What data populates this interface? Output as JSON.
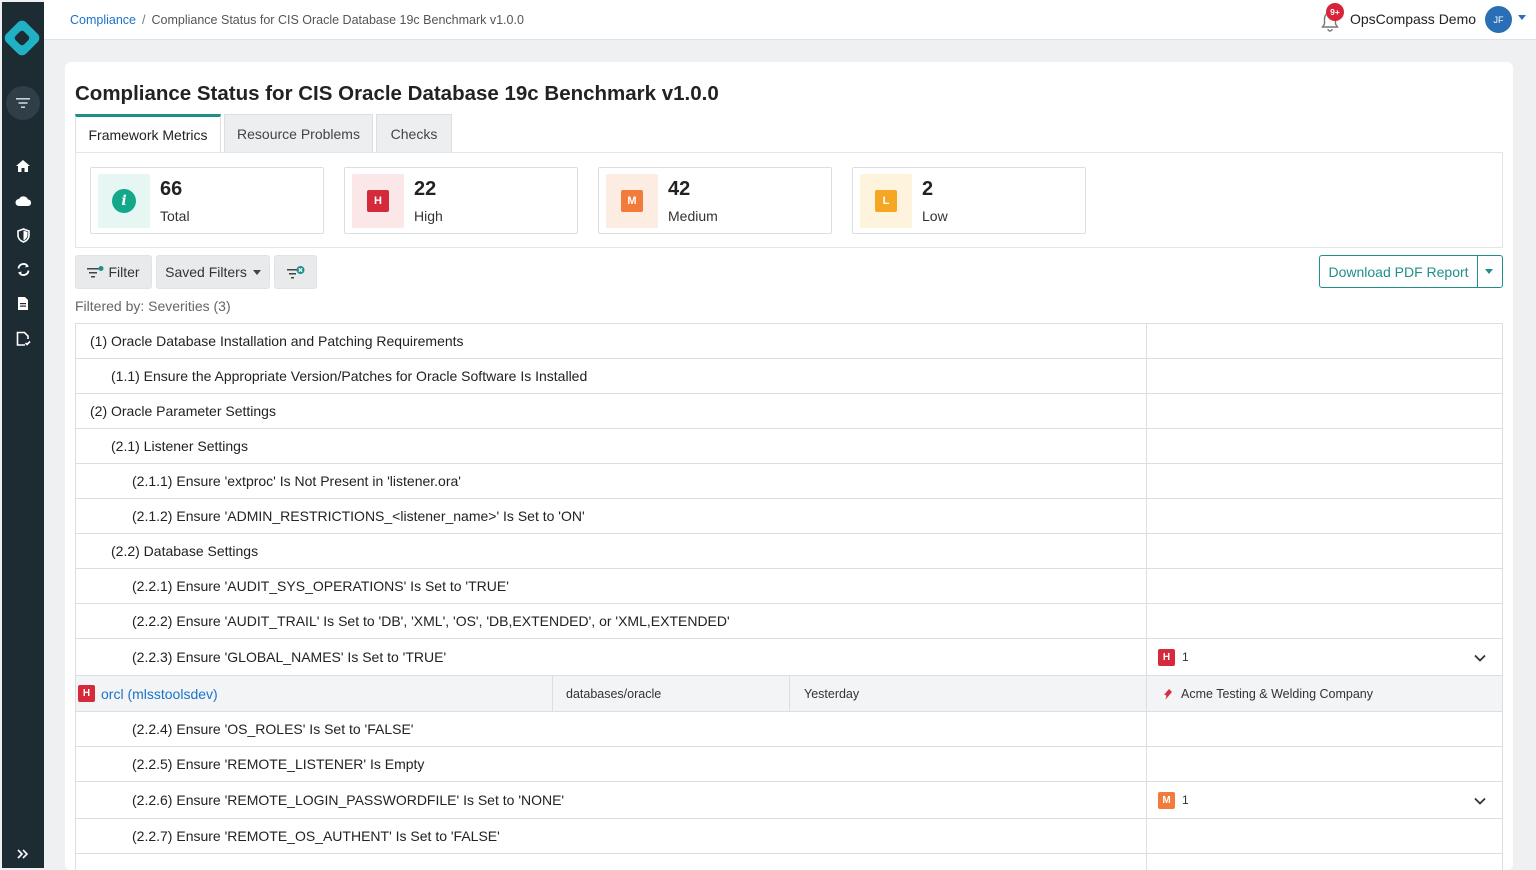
{
  "breadcrumb": {
    "root": "Compliance",
    "separator": "/",
    "current": "Compliance Status for CIS Oracle Database 19c Benchmark v1.0.0"
  },
  "topbar": {
    "notification_count": "9+",
    "org_name": "OpsCompass Demo",
    "avatar_initials": "JF"
  },
  "page": {
    "title": "Compliance Status for CIS Oracle Database 19c Benchmark v1.0.0"
  },
  "tabs": [
    {
      "label": "Framework Metrics",
      "active": true
    },
    {
      "label": "Resource Problems",
      "active": false
    },
    {
      "label": "Checks",
      "active": false
    }
  ],
  "metrics": [
    {
      "value": "66",
      "label": "Total",
      "icon": "info-icon",
      "badge": "i"
    },
    {
      "value": "22",
      "label": "High",
      "icon": "severity-high-icon",
      "badge": "H"
    },
    {
      "value": "42",
      "label": "Medium",
      "icon": "severity-medium-icon",
      "badge": "M"
    },
    {
      "value": "2",
      "label": "Low",
      "icon": "severity-low-icon",
      "badge": "L"
    }
  ],
  "toolbar": {
    "filter_label": "Filter",
    "saved_filters_label": "Saved Filters",
    "download_label": "Download PDF Report"
  },
  "filtered_by": "Filtered by: Severities (3)",
  "rows": [
    {
      "text": "(1) Oracle Database Installation and Patching Requirements"
    },
    {
      "text": "(1.1) Ensure the Appropriate Version/Patches for Oracle Software Is Installed"
    },
    {
      "text": "(2) Oracle Parameter Settings"
    },
    {
      "text": "(2.1) Listener Settings"
    },
    {
      "text": "(2.1.1) Ensure 'extproc' Is Not Present in 'listener.ora'"
    },
    {
      "text": "(2.1.2) Ensure 'ADMIN_RESTRICTIONS_<listener_name>' Is Set to 'ON'"
    },
    {
      "text": "(2.2) Database Settings"
    },
    {
      "text": "(2.2.1) Ensure 'AUDIT_SYS_OPERATIONS' Is Set to 'TRUE'"
    },
    {
      "text": "(2.2.2) Ensure 'AUDIT_TRAIL' Is Set to 'DB', 'XML', 'OS', 'DB,EXTENDED', or 'XML,EXTENDED'"
    },
    {
      "text": "(2.2.3) Ensure 'GLOBAL_NAMES' Is Set to 'TRUE'",
      "severity": "H",
      "count": "1"
    },
    {
      "text": "(2.2.4) Ensure 'OS_ROLES' Is Set to 'FALSE'"
    },
    {
      "text": "(2.2.5) Ensure 'REMOTE_LISTENER' Is Empty"
    },
    {
      "text": "(2.2.6) Ensure 'REMOTE_LOGIN_PASSWORDFILE' Is Set to 'NONE'",
      "severity": "M",
      "count": "1"
    },
    {
      "text": "(2.2.7) Ensure 'REMOTE_OS_AUTHENT' Is Set to 'FALSE'"
    }
  ],
  "resource": {
    "severity": "H",
    "name": "orcl (mlsstoolsdev)",
    "type": "databases/oracle",
    "last_seen": "Yesterday",
    "company": "Acme Testing & Welding Company"
  },
  "colors": {
    "accent": "#1f8f8a",
    "sidebar": "#1d2b33",
    "high": "#d42a3c",
    "medium": "#f27a3a",
    "low": "#f5a623",
    "link": "#1a73c8"
  }
}
